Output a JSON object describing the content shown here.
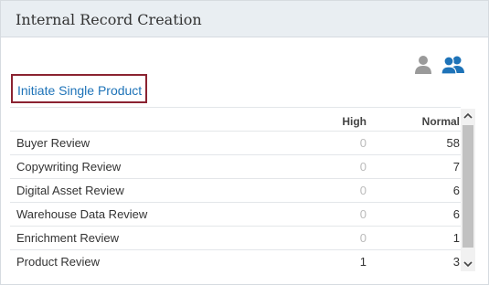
{
  "header": {
    "title": "Internal Record Creation"
  },
  "toolbar": {
    "single_user_icon": "user-icon",
    "multi_user_icon": "users-icon",
    "single_color": "#9a9a9a",
    "multi_color": "#1e73b8"
  },
  "initiate": {
    "label": "Initiate Single Product"
  },
  "table": {
    "columns": [
      "",
      "High",
      "Normal"
    ],
    "rows": [
      {
        "name": "Buyer Review",
        "high": "0",
        "normal": "58"
      },
      {
        "name": "Copywriting Review",
        "high": "0",
        "normal": "7"
      },
      {
        "name": "Digital Asset Review",
        "high": "0",
        "normal": "6"
      },
      {
        "name": "Warehouse Data Review",
        "high": "0",
        "normal": "6"
      },
      {
        "name": "Enrichment Review",
        "high": "0",
        "normal": "1"
      },
      {
        "name": "Product Review",
        "high": "1",
        "normal": "3"
      }
    ]
  }
}
